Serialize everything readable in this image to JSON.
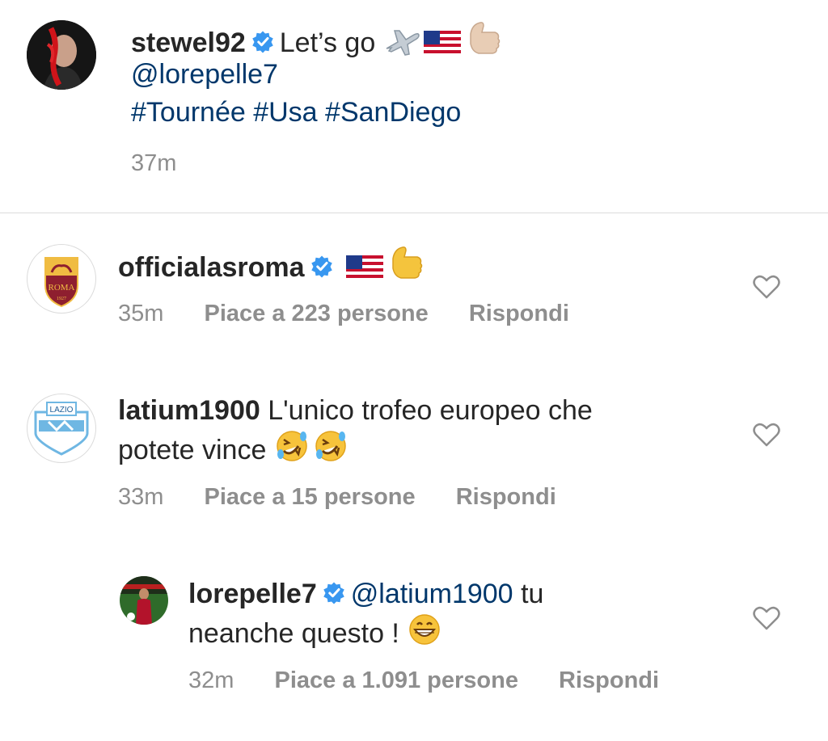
{
  "caption": {
    "username": "stewel92",
    "text": "Let’s go",
    "mention": "@lorepelle7",
    "hashtags": "#Tournée #Usa #SanDiego",
    "time": "37m"
  },
  "comments": [
    {
      "username": "officialasroma",
      "text": "",
      "time": "35m",
      "likes": "Piace a 223 persone",
      "reply": "Rispondi",
      "avatar_text": "ROMA",
      "avatar_year": "1927"
    },
    {
      "username": "latium1900",
      "text": "L'unico trofeo europeo che",
      "text2": "potete vince",
      "time": "33m",
      "likes": "Piace a 15 persone",
      "reply": "Rispondi",
      "avatar_text": "LAZIO"
    },
    {
      "username": "lorepelle7",
      "mention": "@latium1900",
      "text": "tu",
      "text2": "neanche questo !",
      "time": "32m",
      "likes": "Piace a 1.091 persone",
      "reply": "Rispondi"
    }
  ],
  "colors": {
    "link": "#00376b",
    "meta": "#8e8e8e",
    "verified": "#3897f0",
    "heart_outline": "#8e8e8e"
  },
  "icons": [
    "verified-badge-icon",
    "airplane-emoji",
    "us-flag-emoji",
    "thumbs-up-emoji",
    "rolling-laughing-emoji",
    "grinning-emoji",
    "heart-icon"
  ]
}
